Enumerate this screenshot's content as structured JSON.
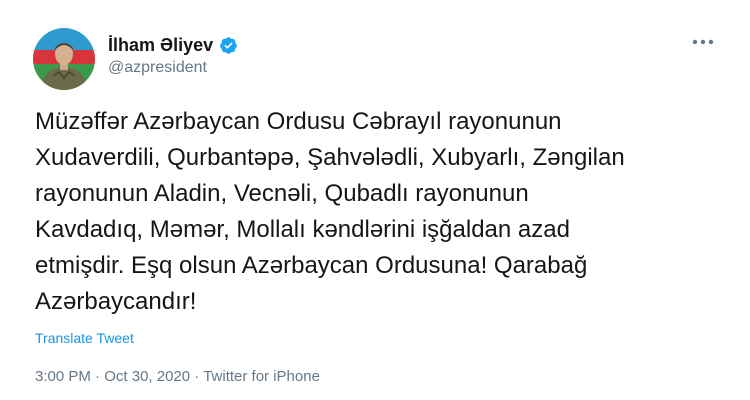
{
  "tweet": {
    "author_name": "İlham Əliyev",
    "author_handle": "@azpresident",
    "verified": true,
    "text": "Müzəffər Azərbaycan Ordusu Cəbrayıl rayonunun\nXudaverdili, Qurbantəpə, Şahvələdli, Xubyarlı, Zəngilan\nrayonunun Aladin, Vecnəli, Qubadlı rayonunun\nKavdadıq, Məmər, Mollalı kəndlərini işğaldan azad\netmişdir. Eşq olsun Azərbaycan Ordusuna! Qarabağ\nAzərbaycandır!",
    "translate_label": "Translate Tweet",
    "time": "3:00 PM",
    "separator": "·",
    "date": "Oct 30, 2020",
    "source": "Twitter for iPhone"
  },
  "icons": {
    "verified": "verified-badge-icon",
    "more": "more-options-icon"
  },
  "colors": {
    "accent": "#1da1f2",
    "link": "#1b95e0",
    "muted": "#657786",
    "text": "#14171a"
  }
}
